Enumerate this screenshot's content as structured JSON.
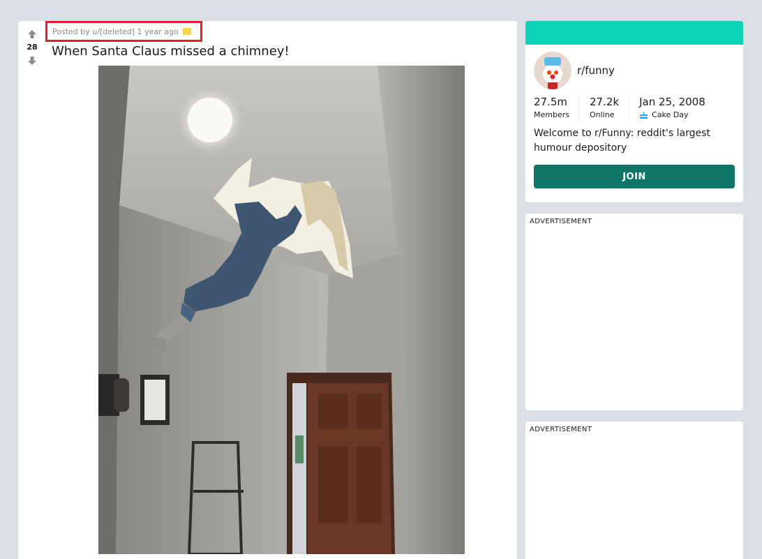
{
  "post": {
    "vote_count": "28",
    "meta": "Posted by u/[deleted] 1 year ago",
    "title": "When Santa Claus missed a chimney!"
  },
  "community": {
    "name": "r/funny",
    "members_value": "27.5m",
    "members_label": "Members",
    "online_value": "27.2k",
    "online_label": "Online",
    "created_value": "Jan 25, 2008",
    "created_label": "Cake Day",
    "description": "Welcome to r/Funny: reddit's largest humour depository",
    "join_label": "JOIN",
    "banner_color": "#0dd3bb",
    "join_color": "#0e7567"
  },
  "ads": {
    "label_1": "ADVERTISEMENT",
    "label_2": "ADVERTISEMENT"
  },
  "colors": {
    "background": "#dae0e6",
    "highlight_border": "#e0202a"
  }
}
